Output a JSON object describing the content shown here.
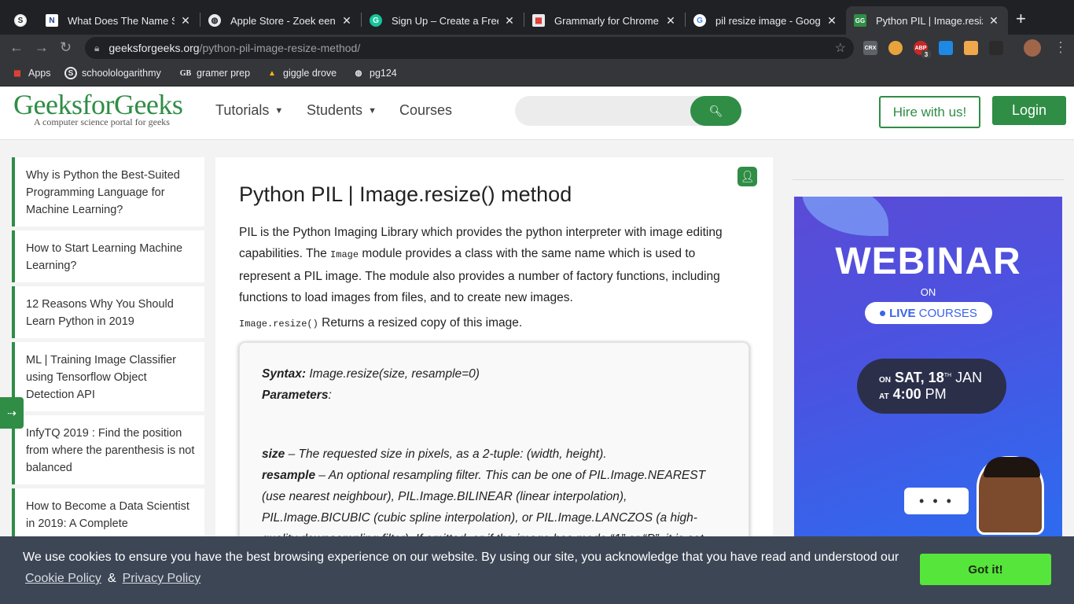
{
  "browser": {
    "tabs": [
      {
        "title": "What Does The Name Se",
        "icon": "noun-n-icon"
      },
      {
        "title": "Apple Store - Zoek een S",
        "icon": "globe-icon"
      },
      {
        "title": "Sign Up – Create a Free A",
        "icon": "grammarly-icon"
      },
      {
        "title": "Grammarly for Chrome -",
        "icon": "chrome-store-icon"
      },
      {
        "title": "pil resize image - Google",
        "icon": "google-icon"
      },
      {
        "title": "Python PIL | Image.resize",
        "icon": "gfg-icon"
      }
    ],
    "url_domain": "geeksforgeeks.org",
    "url_path": "/python-pil-image-resize-method/",
    "extensions": [
      "CRX",
      "ABP",
      "3"
    ],
    "bookmarks": [
      "Apps",
      "schoolologarithmy",
      "gramer prep",
      "giggle drove",
      "pg124"
    ]
  },
  "header": {
    "logo": "GeeksforGeeks",
    "tagline": "A computer science portal for geeks",
    "menu": [
      "Tutorials",
      "Students",
      "Courses"
    ],
    "hire_label": "Hire with us!",
    "login_label": "Login"
  },
  "sidebar": {
    "items": [
      "Why is Python the Best-Suited Programming Language for Machine Learning?",
      "How to Start Learning Machine Learning?",
      "12 Reasons Why You Should Learn Python in 2019",
      "ML | Training Image Classifier using Tensorflow Object Detection API",
      "InfyTQ 2019 : Find the position from where the parenthesis is not balanced",
      "How to Become a Data Scientist in 2019: A Complete"
    ]
  },
  "article": {
    "title": "Python PIL | Image.resize() method",
    "intro_1": "PIL is the Python Imaging Library which provides the python interpreter with image editing capabilities. The",
    "intro_code": "Image",
    "intro_2": "module provides a class with the same name which is used to represent a PIL image. The module also provides a number of factory functions, including functions to load images from files, and to create new images.",
    "returns_code": "Image.resize()",
    "returns_text": "Returns a resized copy of this image.",
    "syntax_label": "Syntax:",
    "syntax_value": "Image.resize(size, resample=0)",
    "params_label": "Parameters",
    "params_colon": ":",
    "size_label": "size",
    "size_text": "– The requested size in pixels, as a 2-tuple: (width, height).",
    "resample_label": "resample",
    "resample_text": "– An optional resampling filter. This can be one of PIL.Image.NEAREST (use nearest neighbour), PIL.Image.BILINEAR (linear interpolation), PIL.Image.BICUBIC (cubic spline interpolation), or PIL.Image.LANCZOS (a high-quality downsampling filter). If omitted, or if the image has mode “1” or “P”, it is set"
  },
  "ad": {
    "webinar": "WEBINAR",
    "on": "ON",
    "live": "LIVE",
    "courses": "COURSES",
    "on_small": "ON",
    "day": "SAT, 18",
    "th": "TH",
    "month": "JAN",
    "at_small": "AT",
    "time": "4:00",
    "pm": "PM",
    "bubble": "• • •"
  },
  "cookie": {
    "message": "We use cookies to ensure you have the best browsing experience on our website. By using our site, you acknowledge that you have read and understood our",
    "policy": "Cookie Policy",
    "amp": "&",
    "privacy": "Privacy Policy",
    "button": "Got it!"
  },
  "colors": {
    "brand": "#2f8d46",
    "cookie_bg": "#3d4655",
    "cookie_button": "#56e53a"
  }
}
